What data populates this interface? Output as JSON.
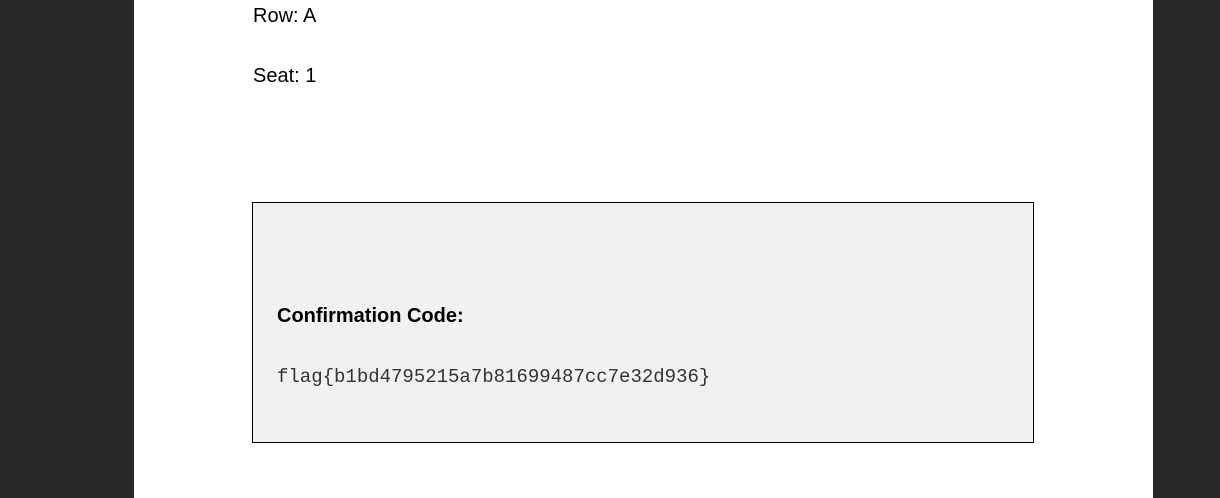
{
  "ticket": {
    "row": "Row: A",
    "seat": "Seat: 1"
  },
  "confirmation": {
    "title": "Confirmation Code:",
    "code": "flag{b1bd4795215a7b81699487cc7e32d936}"
  },
  "colors": {
    "viewer_background": "#282828",
    "page_background": "#ffffff",
    "box_background": "#f1f1f1",
    "box_border": "#000000"
  }
}
